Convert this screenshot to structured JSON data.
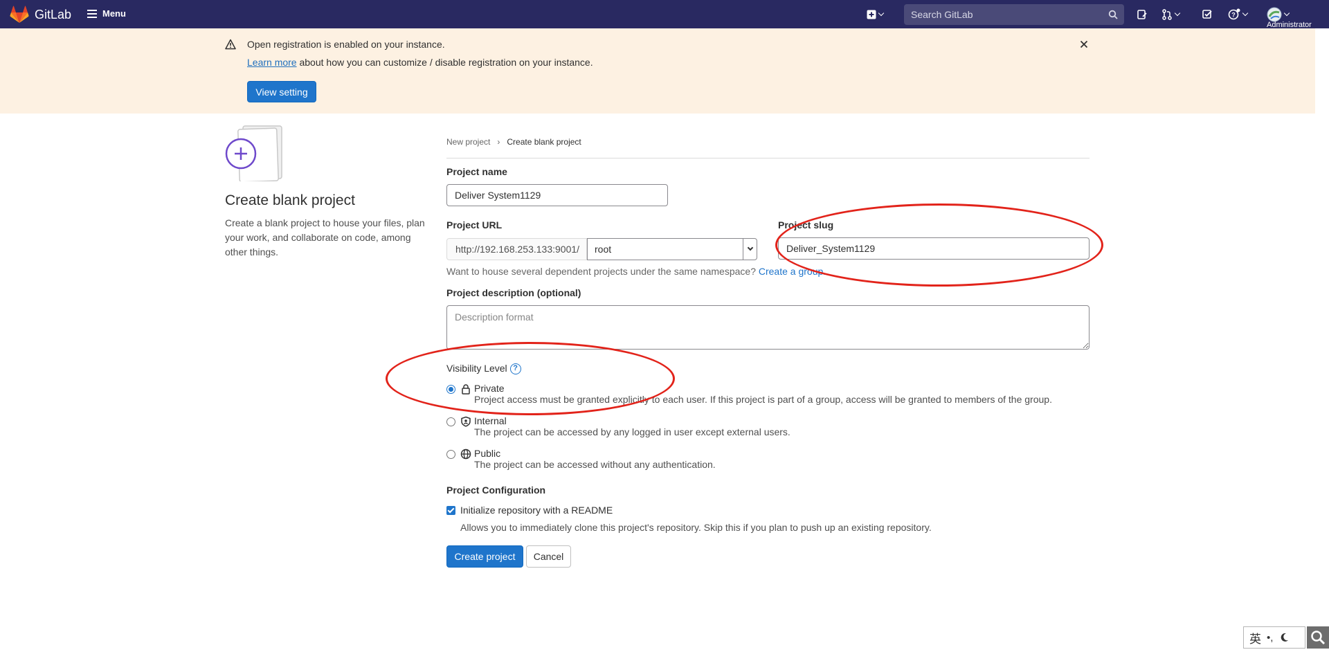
{
  "topnav": {
    "brand": "GitLab",
    "menu_label": "Menu",
    "search_placeholder": "Search GitLab",
    "user_label": "Administrator"
  },
  "banner": {
    "title": "Open registration is enabled on your instance.",
    "learn_more": "Learn more",
    "learn_more_suffix": " about how you can customize / disable registration on your instance.",
    "view_setting": "View setting"
  },
  "left": {
    "title": "Create blank project",
    "description": "Create a blank project to house your files, plan your work, and collaborate on code, among other things."
  },
  "breadcrumb": {
    "parent": "New project",
    "separator": "›",
    "current": "Create blank project"
  },
  "form": {
    "project_name_label": "Project name",
    "project_name_value": "Deliver System1129",
    "project_url_label": "Project URL",
    "url_prefix": "http://192.168.253.133:9001/",
    "namespace": "root",
    "project_slug_label": "Project slug",
    "project_slug_value": "Deliver_System1129",
    "group_help": "Want to house several dependent projects under the same namespace? ",
    "create_group": "Create a group.",
    "description_label": "Project description (optional)",
    "description_placeholder": "Description format",
    "visibility_label": "Visibility Level",
    "visibility": [
      {
        "name": "Private",
        "description": "Project access must be granted explicitly to each user. If this project is part of a group, access will be granted to members of the group.",
        "selected": true,
        "icon": "lock-icon"
      },
      {
        "name": "Internal",
        "description": "The project can be accessed by any logged in user except external users.",
        "selected": false,
        "icon": "shield-icon"
      },
      {
        "name": "Public",
        "description": "The project can be accessed without any authentication.",
        "selected": false,
        "icon": "globe-icon"
      }
    ],
    "config_label": "Project Configuration",
    "readme_label": "Initialize repository with a README",
    "readme_checked": true,
    "readme_help": "Allows you to immediately clone this project's repository. Skip this if you plan to push up an existing repository.",
    "create_button": "Create project",
    "cancel_button": "Cancel"
  },
  "ime": {
    "label": "英"
  },
  "colors": {
    "nav": "#292961",
    "banner": "#fdf1e2",
    "primary": "#1f75cb",
    "annotation": "#e2231a"
  }
}
